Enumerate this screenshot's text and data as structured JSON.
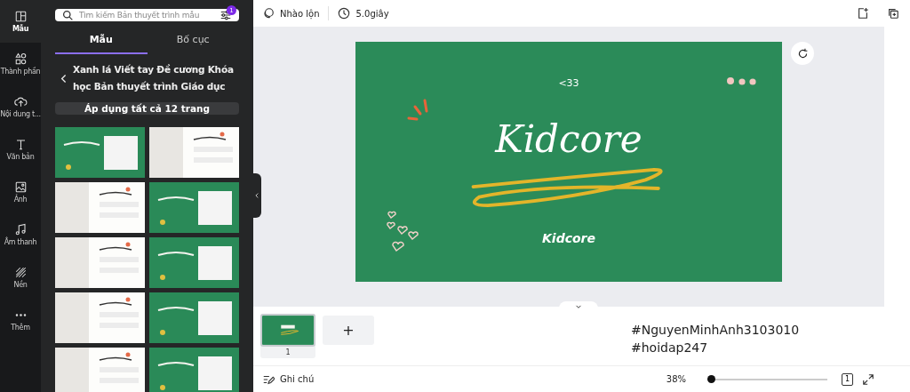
{
  "rail": [
    {
      "kind": "template",
      "label": "Mẫu",
      "selected": true
    },
    {
      "kind": "elements",
      "label": "Thành phần",
      "selected": false
    },
    {
      "kind": "upload",
      "label": "Nội dung t...",
      "selected": false
    },
    {
      "kind": "text",
      "label": "Văn bản",
      "selected": false
    },
    {
      "label": "Ảnh",
      "selected": false
    },
    {
      "kind": "audio",
      "label": "Âm thanh",
      "selected": false
    },
    {
      "kind": "background",
      "label": "Nền",
      "selected": false
    },
    {
      "kind": "more",
      "label": "Thêm",
      "selected": false
    }
  ],
  "search": {
    "placeholder": "Tìm kiếm Bản thuyết trình mẫu",
    "filter_badge": "1"
  },
  "tabs": [
    {
      "label": "Mẫu",
      "selected": true
    },
    {
      "label": "Bố cục",
      "selected": false
    }
  ],
  "collection": {
    "title": "Xanh lá Viết tay Đề cương Khóa học Bản thuyết trình Giáo dục",
    "apply_button": "Áp dụng tất cả 12 trang"
  },
  "toolbar": {
    "animate": "Nhào lộn",
    "duration": "5.0giây"
  },
  "slide": {
    "top_text": "<33",
    "title": "Kidcore",
    "subtitle": "Kidcore"
  },
  "pages": [
    {
      "number": "1",
      "selected": true
    }
  ],
  "add_page": "+",
  "hashtags": [
    "#NguyenMinhAnh3103010",
    "#hoidap247"
  ],
  "footer": {
    "notes": "Ghi chú",
    "zoom": "38%",
    "zoom_slider": {
      "level": 0.0
    },
    "page_count": "1"
  }
}
